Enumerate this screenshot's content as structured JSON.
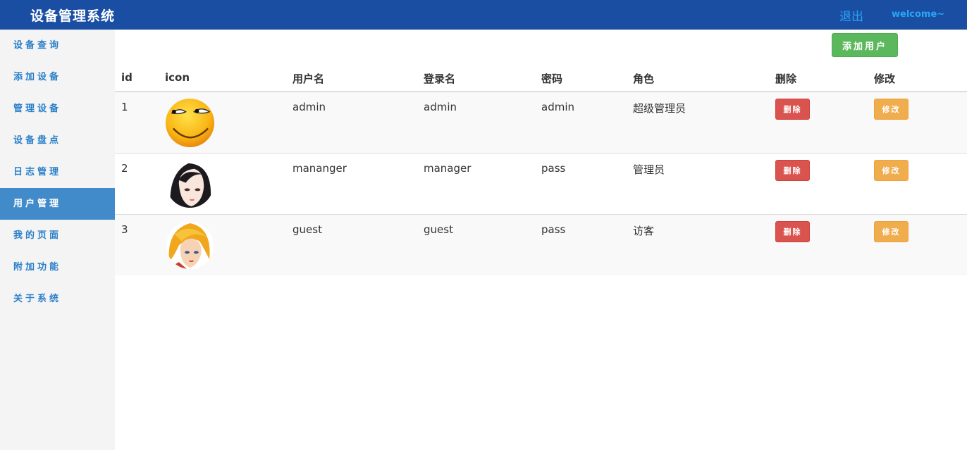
{
  "header": {
    "title": "设备管理系统",
    "logout_label": "退出",
    "welcome_text": "welcome~"
  },
  "sidebar": {
    "items": [
      {
        "label": "设备查询"
      },
      {
        "label": "添加设备"
      },
      {
        "label": "管理设备"
      },
      {
        "label": "设备盘点"
      },
      {
        "label": "日志管理"
      },
      {
        "label": "用户管理",
        "active": true
      },
      {
        "label": "我的页面"
      },
      {
        "label": "附加功能"
      },
      {
        "label": "关于系统"
      }
    ]
  },
  "toolbar": {
    "add_user_label": "添加用户"
  },
  "table": {
    "columns": [
      "id",
      "icon",
      "用户名",
      "登录名",
      "密码",
      "角色",
      "删除",
      "修改"
    ],
    "rows": [
      {
        "id": "1",
        "icon": "smiley-avatar-icon",
        "username": "admin",
        "login": "admin",
        "password": "admin",
        "role": "超级管理员",
        "delete_label": "删除",
        "edit_label": "修改"
      },
      {
        "id": "2",
        "icon": "dark-hair-girl-avatar-icon",
        "username": "mananger",
        "login": "manager",
        "password": "pass",
        "role": "管理员",
        "delete_label": "删除",
        "edit_label": "修改"
      },
      {
        "id": "3",
        "icon": "blonde-girl-avatar-icon",
        "username": "guest",
        "login": "guest",
        "password": "pass",
        "role": "访客",
        "delete_label": "删除",
        "edit_label": "修改"
      }
    ]
  },
  "colors": {
    "header_bg": "#1a4ea3",
    "link": "#2aa5f5",
    "sidebar_active": "#428bca",
    "success": "#5cb85c",
    "danger": "#d9534f",
    "warning": "#f0ad4e"
  }
}
